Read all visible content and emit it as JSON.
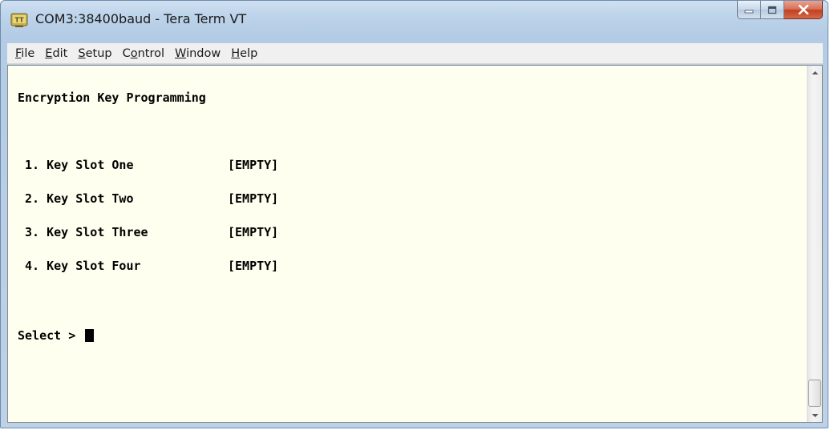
{
  "window": {
    "title": "COM3:38400baud - Tera Term VT",
    "icon": "tera-term-app-icon",
    "controls": {
      "minimize_icon": "minimize-icon",
      "maximize_icon": "maximize-icon",
      "close_icon": "close-icon"
    },
    "close_color": "#c8432a"
  },
  "menubar": {
    "items": [
      {
        "accel": "F",
        "rest": "ile"
      },
      {
        "accel": "E",
        "rest": "dit"
      },
      {
        "accel": "S",
        "rest": "etup"
      },
      {
        "pre": "C",
        "accel": "o",
        "rest": "ntrol"
      },
      {
        "accel": "W",
        "rest": "indow"
      },
      {
        "accel": "H",
        "rest": "elp"
      }
    ]
  },
  "terminal": {
    "background": "#ffffef",
    "foreground": "#000000",
    "heading": "Encryption Key Programming",
    "menu": [
      {
        "label": " 1. Key Slot One",
        "status": "[EMPTY]"
      },
      {
        "label": " 2. Key Slot Two",
        "status": "[EMPTY]"
      },
      {
        "label": " 3. Key Slot Three",
        "status": "[EMPTY]"
      },
      {
        "label": " 4. Key Slot Four",
        "status": "[EMPTY]"
      }
    ],
    "prompt": "Select > "
  }
}
